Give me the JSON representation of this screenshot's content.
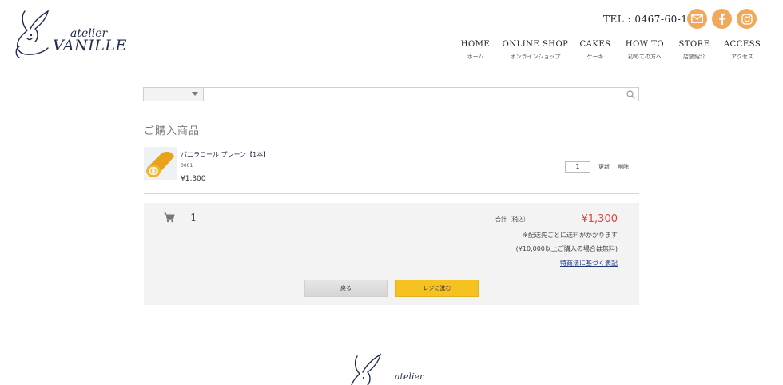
{
  "brand": {
    "small": "atelier",
    "big": "VANILLE"
  },
  "header": {
    "tel": "TEL : 0467-60-1432",
    "sns": [
      "mail-icon",
      "facebook-icon",
      "instagram-icon"
    ]
  },
  "nav": [
    {
      "label": "HOME",
      "sub": "ホーム"
    },
    {
      "label": "ONLINE SHOP",
      "sub": "オンラインショップ"
    },
    {
      "label": "CAKES",
      "sub": "ケーキ"
    },
    {
      "label": "HOW TO",
      "sub": "初めての方へ"
    },
    {
      "label": "STORE",
      "sub": "店舗紹介"
    },
    {
      "label": "ACCESS",
      "sub": "アクセス"
    }
  ],
  "search": {
    "category": "",
    "query": ""
  },
  "cart": {
    "title": "ご購入商品",
    "item": {
      "name": "バニラロール プレーン【1本】",
      "code": "0001",
      "price": "¥1,300",
      "qty": "1",
      "update": "更新",
      "delete": "削除"
    },
    "count": "1",
    "total_label": "合計（税込）",
    "total": "¥1,300",
    "note1": "※配送先ごとに送料がかかります",
    "note2": "(¥10,000以上ご購入の場合は無料)",
    "law_link": "特商法に基づく表記",
    "back": "戻る",
    "checkout": "レジに進む"
  },
  "footer": {
    "brand_small": "atelier"
  },
  "colors": {
    "accent_orange": "#f2a85a",
    "price_red": "#e2413e",
    "checkout_yellow": "#f5c222",
    "navy": "#1f2a4d"
  }
}
